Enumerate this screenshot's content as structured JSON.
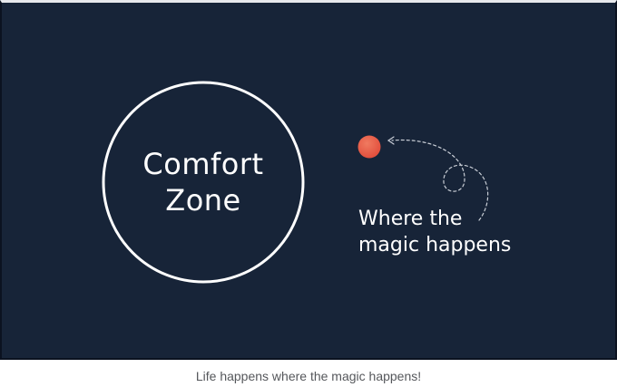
{
  "diagram": {
    "circle_label": "Comfort\nZone",
    "magic_label": "Where the\nmagic happens",
    "colors": {
      "background": "#172438",
      "circle_stroke": "#ffffff",
      "dot": "#e95a45",
      "text": "#ffffff"
    },
    "icons": {
      "dot": "orange-dot",
      "arrow": "dashed-curved-arrow"
    }
  },
  "caption": "Life happens where the magic happens!"
}
